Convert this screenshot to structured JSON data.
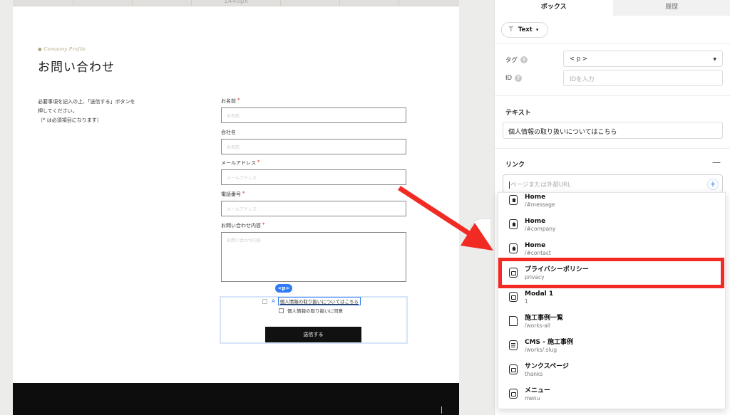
{
  "ruler": {
    "label": "1440px"
  },
  "page": {
    "eyebrow": "● Company Profile",
    "title": "お問い合わせ",
    "intro_lines": [
      "必要事項を記入の上、「送信する」ボタンを",
      "押してください。",
      "（* は必須項目になります）"
    ],
    "fields": [
      {
        "label": "お名前",
        "required": "*",
        "placeholder": "お名前"
      },
      {
        "label": "会社名",
        "required": "",
        "placeholder": "お名前"
      },
      {
        "label": "メールアドレス",
        "required": "*",
        "placeholder": "メールアドレス"
      },
      {
        "label": "電話番号",
        "required": "*",
        "placeholder": "メールアドレス"
      },
      {
        "label": "お問い合わせ内容",
        "required": "*",
        "placeholder": "お問い合わせ内容"
      }
    ],
    "tag_badge": "<p>",
    "privacy_link": "個人情報の取り扱いについてはこちら",
    "agree_label": "個人情報の取り扱いに同意",
    "submit": "送信する"
  },
  "panel": {
    "tabs": [
      "ボックス",
      "履歴"
    ],
    "element_type": "Text",
    "tag_label": "タグ",
    "tag_value": "< p >",
    "id_label": "ID",
    "id_placeholder": "IDを入力",
    "text_section": "テキスト",
    "text_value": "個人情報の取り扱いについてはこちら",
    "link_section": "リンク",
    "link_collapse": "—",
    "link_placeholder": "ページまたは外部URL",
    "link_add": "+",
    "dropdown": [
      {
        "title": "Home",
        "sub": "/#message",
        "icon": "home-icon"
      },
      {
        "title": "Home",
        "sub": "/#company",
        "icon": "home-icon"
      },
      {
        "title": "Home",
        "sub": "/#contact",
        "icon": "home-icon"
      },
      {
        "title": "プライバシーポリシー",
        "sub": "privacy",
        "icon": "modal-icon"
      },
      {
        "title": "Modal 1",
        "sub": "1",
        "icon": "modal-icon"
      },
      {
        "title": "施工事例一覧",
        "sub": "/works-all",
        "icon": "page-icon"
      },
      {
        "title": "CMS - 施工事例",
        "sub": "/works/:slug",
        "icon": "cms-icon"
      },
      {
        "title": "サンクスページ",
        "sub": "thanks",
        "icon": "modal-icon"
      },
      {
        "title": "メニュー",
        "sub": "menu",
        "icon": "modal-icon"
      }
    ]
  },
  "colors": {
    "highlight": "#f12b24",
    "accent": "#2f7cf6",
    "required": "#d0352c"
  }
}
